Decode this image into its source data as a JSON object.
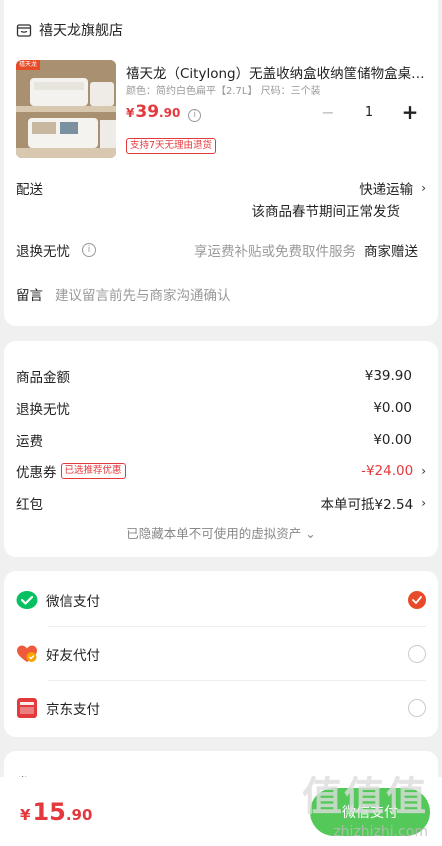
{
  "store": {
    "name": "禧天龙旗舰店"
  },
  "product": {
    "tag": "禧天龙",
    "title": "禧天龙（Citylong）无盖收纳盒收纳筐储物盒桌面收纳",
    "spec": "颜色：简约白色扁平【2.7L】  尺码：三个装",
    "price_currency": "¥",
    "price_int": "39",
    "price_dec": ".90",
    "quantity": "1",
    "minus": "−",
    "plus": "+",
    "return_badge": "支持7天无理由退货"
  },
  "delivery": {
    "label": "配送",
    "value": "快递运输",
    "note": "该商品春节期间正常发货"
  },
  "exchange": {
    "label": "退换无忧",
    "desc": "享运费补贴或免费取件服务",
    "value": "商家赠送"
  },
  "message": {
    "label": "留言",
    "placeholder": "建议留言前先与商家沟通确认"
  },
  "summary": {
    "goods_label": "商品金额",
    "goods_value": "¥39.90",
    "exchange_label": "退换无忧",
    "exchange_value": "¥0.00",
    "shipping_label": "运费",
    "shipping_value": "¥0.00",
    "coupon_label": "优惠券",
    "coupon_tag": "已选推荐优惠",
    "coupon_value": "-¥24.00",
    "redpacket_label": "红包",
    "redpacket_value": "本单可抵¥2.54",
    "hidden_note": "已隐藏本单不可使用的虚拟资产 ⌄"
  },
  "payments": [
    {
      "label": "微信支付",
      "selected": true
    },
    {
      "label": "好友代付",
      "selected": false
    },
    {
      "label": "京东支付",
      "selected": false
    }
  ],
  "invoice": {
    "label": "发票"
  },
  "footer": {
    "currency": "¥",
    "total_int": "15",
    "total_dec": ".90",
    "pay_button": "微信支付"
  },
  "watermark": {
    "text": "值值值",
    "url": "zhizhizhi.com"
  },
  "colors": {
    "accent": "#e4393c",
    "wechat": "#07c160",
    "check": "#e84b27"
  }
}
